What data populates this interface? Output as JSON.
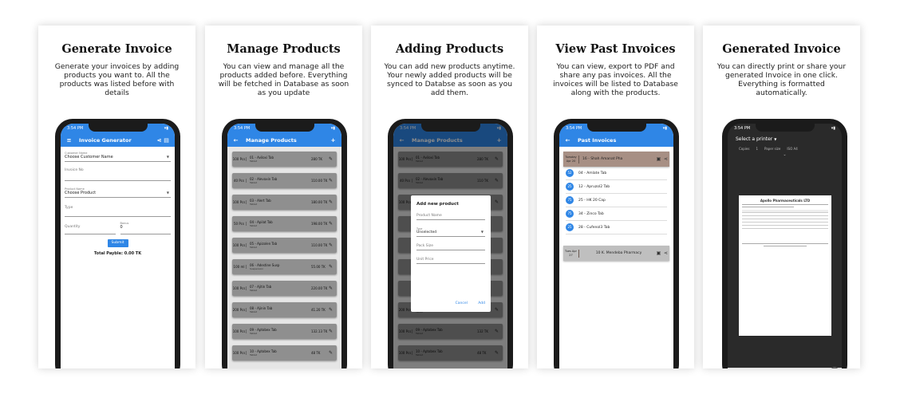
{
  "cards": [
    {
      "title": "Generate Invoice",
      "desc": "Generate your invoices by adding products you want to. All the products was listed before with details"
    },
    {
      "title": "Manage Products",
      "desc": "You can view and manage all the products added before. Everything will be fetched in Database as soon as you update"
    },
    {
      "title": "Adding Products",
      "desc": "You can add new products anytime. Your newly added products will be synced to Databse as soon as you add them."
    },
    {
      "title": "View Past Invoices",
      "desc": "You can view, export to PDF and share any pas invoices. All the invoices will be listed to Database along with the products."
    },
    {
      "title": "Generated Invoice",
      "desc": "You can directly print or share your generated Invoice in one click. Everything is formatted automatically."
    }
  ],
  "status_time": "3:54 PM",
  "s1": {
    "appbar": "Invoice Generator",
    "customer_label": "Customer Name",
    "customer_value": "Choose Customer Name",
    "invoice_label": "Invoice No",
    "product_label": "Product Name",
    "product_value": "Choose Product",
    "type_label": "Type",
    "quantity_label": "Quantity",
    "bonus_label": "Bonus",
    "bonus_value": "0",
    "submit": "Submit",
    "total": "Total Payble: 0.00 TK"
  },
  "s2": {
    "appbar": "Manage Products",
    "rows": [
      {
        "q": "100 Pcs",
        "name": "01 - Aviloxi Tab",
        "sub": "Tablet",
        "price": "280 TK"
      },
      {
        "q": "40 Pcs",
        "name": "02 - Alevaxin Tab",
        "sub": "Tablet",
        "price": "110.00 TK"
      },
      {
        "q": "100 Pcs",
        "name": "03 - Alert Tab",
        "sub": "Tablet",
        "price": "180.00 TK"
      },
      {
        "q": "50 Pcs",
        "name": "04 - Apilat Tab",
        "sub": "Tablet",
        "price": "198.00 TK"
      },
      {
        "q": "100 Pcs",
        "name": "05 - Apizolen Tab",
        "sub": "Tablet",
        "price": "110.00 TK"
      },
      {
        "q": "100 ml",
        "name": "06 - Adestine Susp",
        "sub": "Suspension",
        "price": "55.00 TK"
      },
      {
        "q": "100 Pcs",
        "name": "07 - Ajitin Tab",
        "sub": "Tablet",
        "price": "220.00 TK"
      },
      {
        "q": "200 Pcs",
        "name": "08 - Ajinin Tab",
        "sub": "Tablet",
        "price": "41.20 TK"
      },
      {
        "q": "100 Pcs",
        "name": "09 - Aptobex Tab",
        "sub": "Tablet",
        "price": "132.13 TK"
      },
      {
        "q": "100 Pcs",
        "name": "10 - Aptobex Tab",
        "sub": "Tablet",
        "price": "48 TK"
      }
    ]
  },
  "s3": {
    "appbar": "Manage Products",
    "dialog_title": "Add new product",
    "f_name": "Product Name",
    "f_type_label": "Type",
    "f_type_value": "Unselected",
    "f_size": "Pack Size",
    "f_price": "Unit Price",
    "cancel": "Cancel",
    "add": "Add",
    "rows": [
      {
        "q": "100 Pcs",
        "name": "01 - Aviloxi Tab",
        "sub": "Tablet",
        "price": "280 TK"
      },
      {
        "q": "40 Pcs",
        "name": "02 - Alevaxin Tab",
        "sub": "Tablet",
        "price": "110 TK"
      },
      {
        "q": "100 Pcs",
        "name": "03 - Alert Tab",
        "sub": "Tablet",
        "price": "180 TK"
      },
      {
        "q": "",
        "name": "",
        "sub": "",
        "price": ""
      },
      {
        "q": "",
        "name": "",
        "sub": "",
        "price": ""
      },
      {
        "q": "",
        "name": "",
        "sub": "",
        "price": ""
      },
      {
        "q": "",
        "name": "",
        "sub": "",
        "price": ""
      },
      {
        "q": "200 Pcs",
        "name": "08 - Ajinin Tab",
        "sub": "Tablet",
        "price": "41 TK"
      },
      {
        "q": "100 Pcs",
        "name": "09 - Aptobex Tab",
        "sub": "Tablet",
        "price": "132 TK"
      },
      {
        "q": "100 Pcs",
        "name": "10 - Aptobex Tab",
        "sub": "Tablet",
        "price": "48 TK"
      }
    ]
  },
  "s4": {
    "appbar": "Past Invoices",
    "head1": {
      "date": "Tuesday Apr 20",
      "name": "16 - Shah Amanat Pha"
    },
    "items": [
      {
        "n": "52",
        "name": "04 - Amlate Tab"
      },
      {
        "n": "25",
        "name": "12 - Apruzol2 Tab"
      },
      {
        "n": "75",
        "name": "25 - HK 20 Cap"
      },
      {
        "n": "75",
        "name": "34 - Zinco Tab"
      },
      {
        "n": "25",
        "name": "28 - Cufenol3 Tab"
      }
    ],
    "head2": {
      "date": "Tues Apr 27",
      "name": "10 K. Mendeba Pharmacy"
    }
  },
  "s5": {
    "printer": "Select a printer",
    "copies_label": "Copies",
    "copies": "1",
    "paper_label": "Paper size",
    "paper": "ISO A4",
    "doc_title": "Apollo Pharmaceuticals LTD"
  }
}
